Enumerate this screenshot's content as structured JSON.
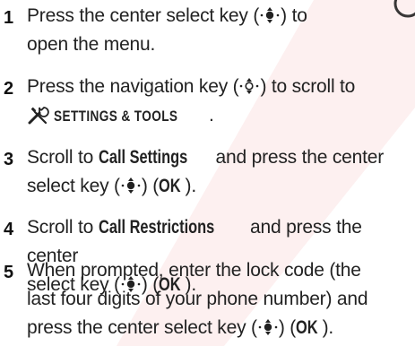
{
  "steps": [
    {
      "number": "1",
      "line1_a": "Press the center select key (",
      "line1_b": ") to",
      "line2": "open the menu."
    },
    {
      "number": "2",
      "line1_a": "Press the navigation key (",
      "line1_b": ") to scroll to",
      "line2_menu": "SETTINGS & TOOLS",
      "line2_end": "."
    },
    {
      "number": "3",
      "line1_a": "Scroll to ",
      "line1_bold": "Call Settings",
      "line1_b": " and press the center",
      "line2_a": "select key (",
      "line2_b": ") (",
      "line2_ok": "OK",
      "line2_c": ")."
    },
    {
      "number": "4",
      "line1_a": "Scroll to ",
      "line1_bold": "Call Restrictions",
      "line1_b": " and press the center",
      "line2_a": "select key (",
      "line2_b": ") (",
      "line2_ok": "OK",
      "line2_c": ")."
    },
    {
      "number": "5",
      "line1": "When prompted, enter the lock code (the",
      "line2": "last four digits of your phone number) and",
      "line3_a": "press the center select key (",
      "line3_b": ") (",
      "line3_ok": "OK",
      "line3_c": ")."
    }
  ],
  "icons": {
    "center_select": "center-select-key-icon",
    "navigation": "navigation-key-icon",
    "settings_tools": "settings-tools-icon"
  },
  "colors": {
    "text": "#222222",
    "watermark": "#f1c4c4"
  }
}
